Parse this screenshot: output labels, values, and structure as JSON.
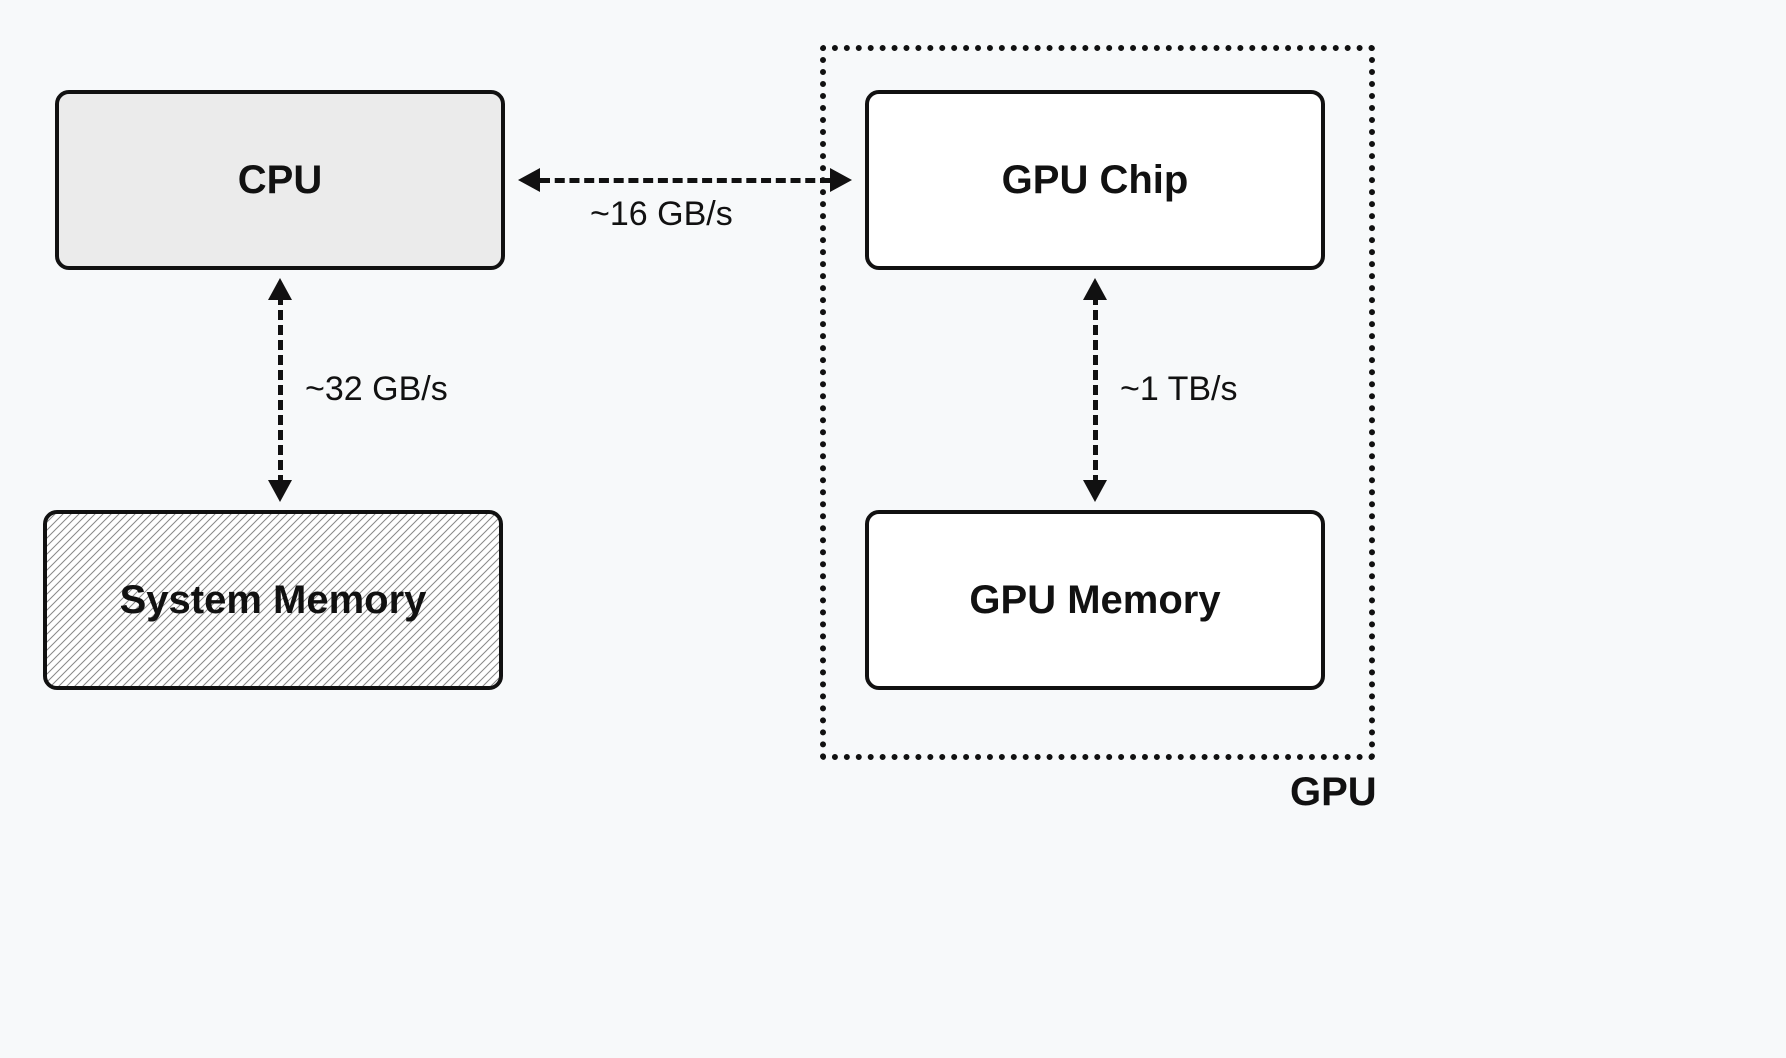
{
  "boxes": {
    "cpu": "CPU",
    "system_memory": "System Memory",
    "gpu_chip": "GPU Chip",
    "gpu_memory": "GPU Memory"
  },
  "container": {
    "gpu_label": "GPU"
  },
  "links": {
    "cpu_sysmem": "~32 GB/s",
    "cpu_gpuchip": "~16 GB/s",
    "gpuchip_gpumem": "~1 TB/s"
  },
  "chart_data": {
    "type": "diagram",
    "nodes": [
      {
        "id": "cpu",
        "label": "CPU",
        "fill": "light-gray"
      },
      {
        "id": "system_memory",
        "label": "System Memory",
        "fill": "hatched"
      },
      {
        "id": "gpu_chip",
        "label": "GPU Chip",
        "fill": "white",
        "group": "gpu"
      },
      {
        "id": "gpu_memory",
        "label": "GPU Memory",
        "fill": "white",
        "group": "gpu"
      }
    ],
    "groups": [
      {
        "id": "gpu",
        "label": "GPU",
        "style": "dotted"
      }
    ],
    "edges": [
      {
        "from": "cpu",
        "to": "system_memory",
        "label": "~32 GB/s",
        "bidirectional": true,
        "style": "dashed"
      },
      {
        "from": "cpu",
        "to": "gpu_chip",
        "label": "~16 GB/s",
        "bidirectional": true,
        "style": "dashed"
      },
      {
        "from": "gpu_chip",
        "to": "gpu_memory",
        "label": "~1 TB/s",
        "bidirectional": true,
        "style": "dashed"
      }
    ]
  }
}
